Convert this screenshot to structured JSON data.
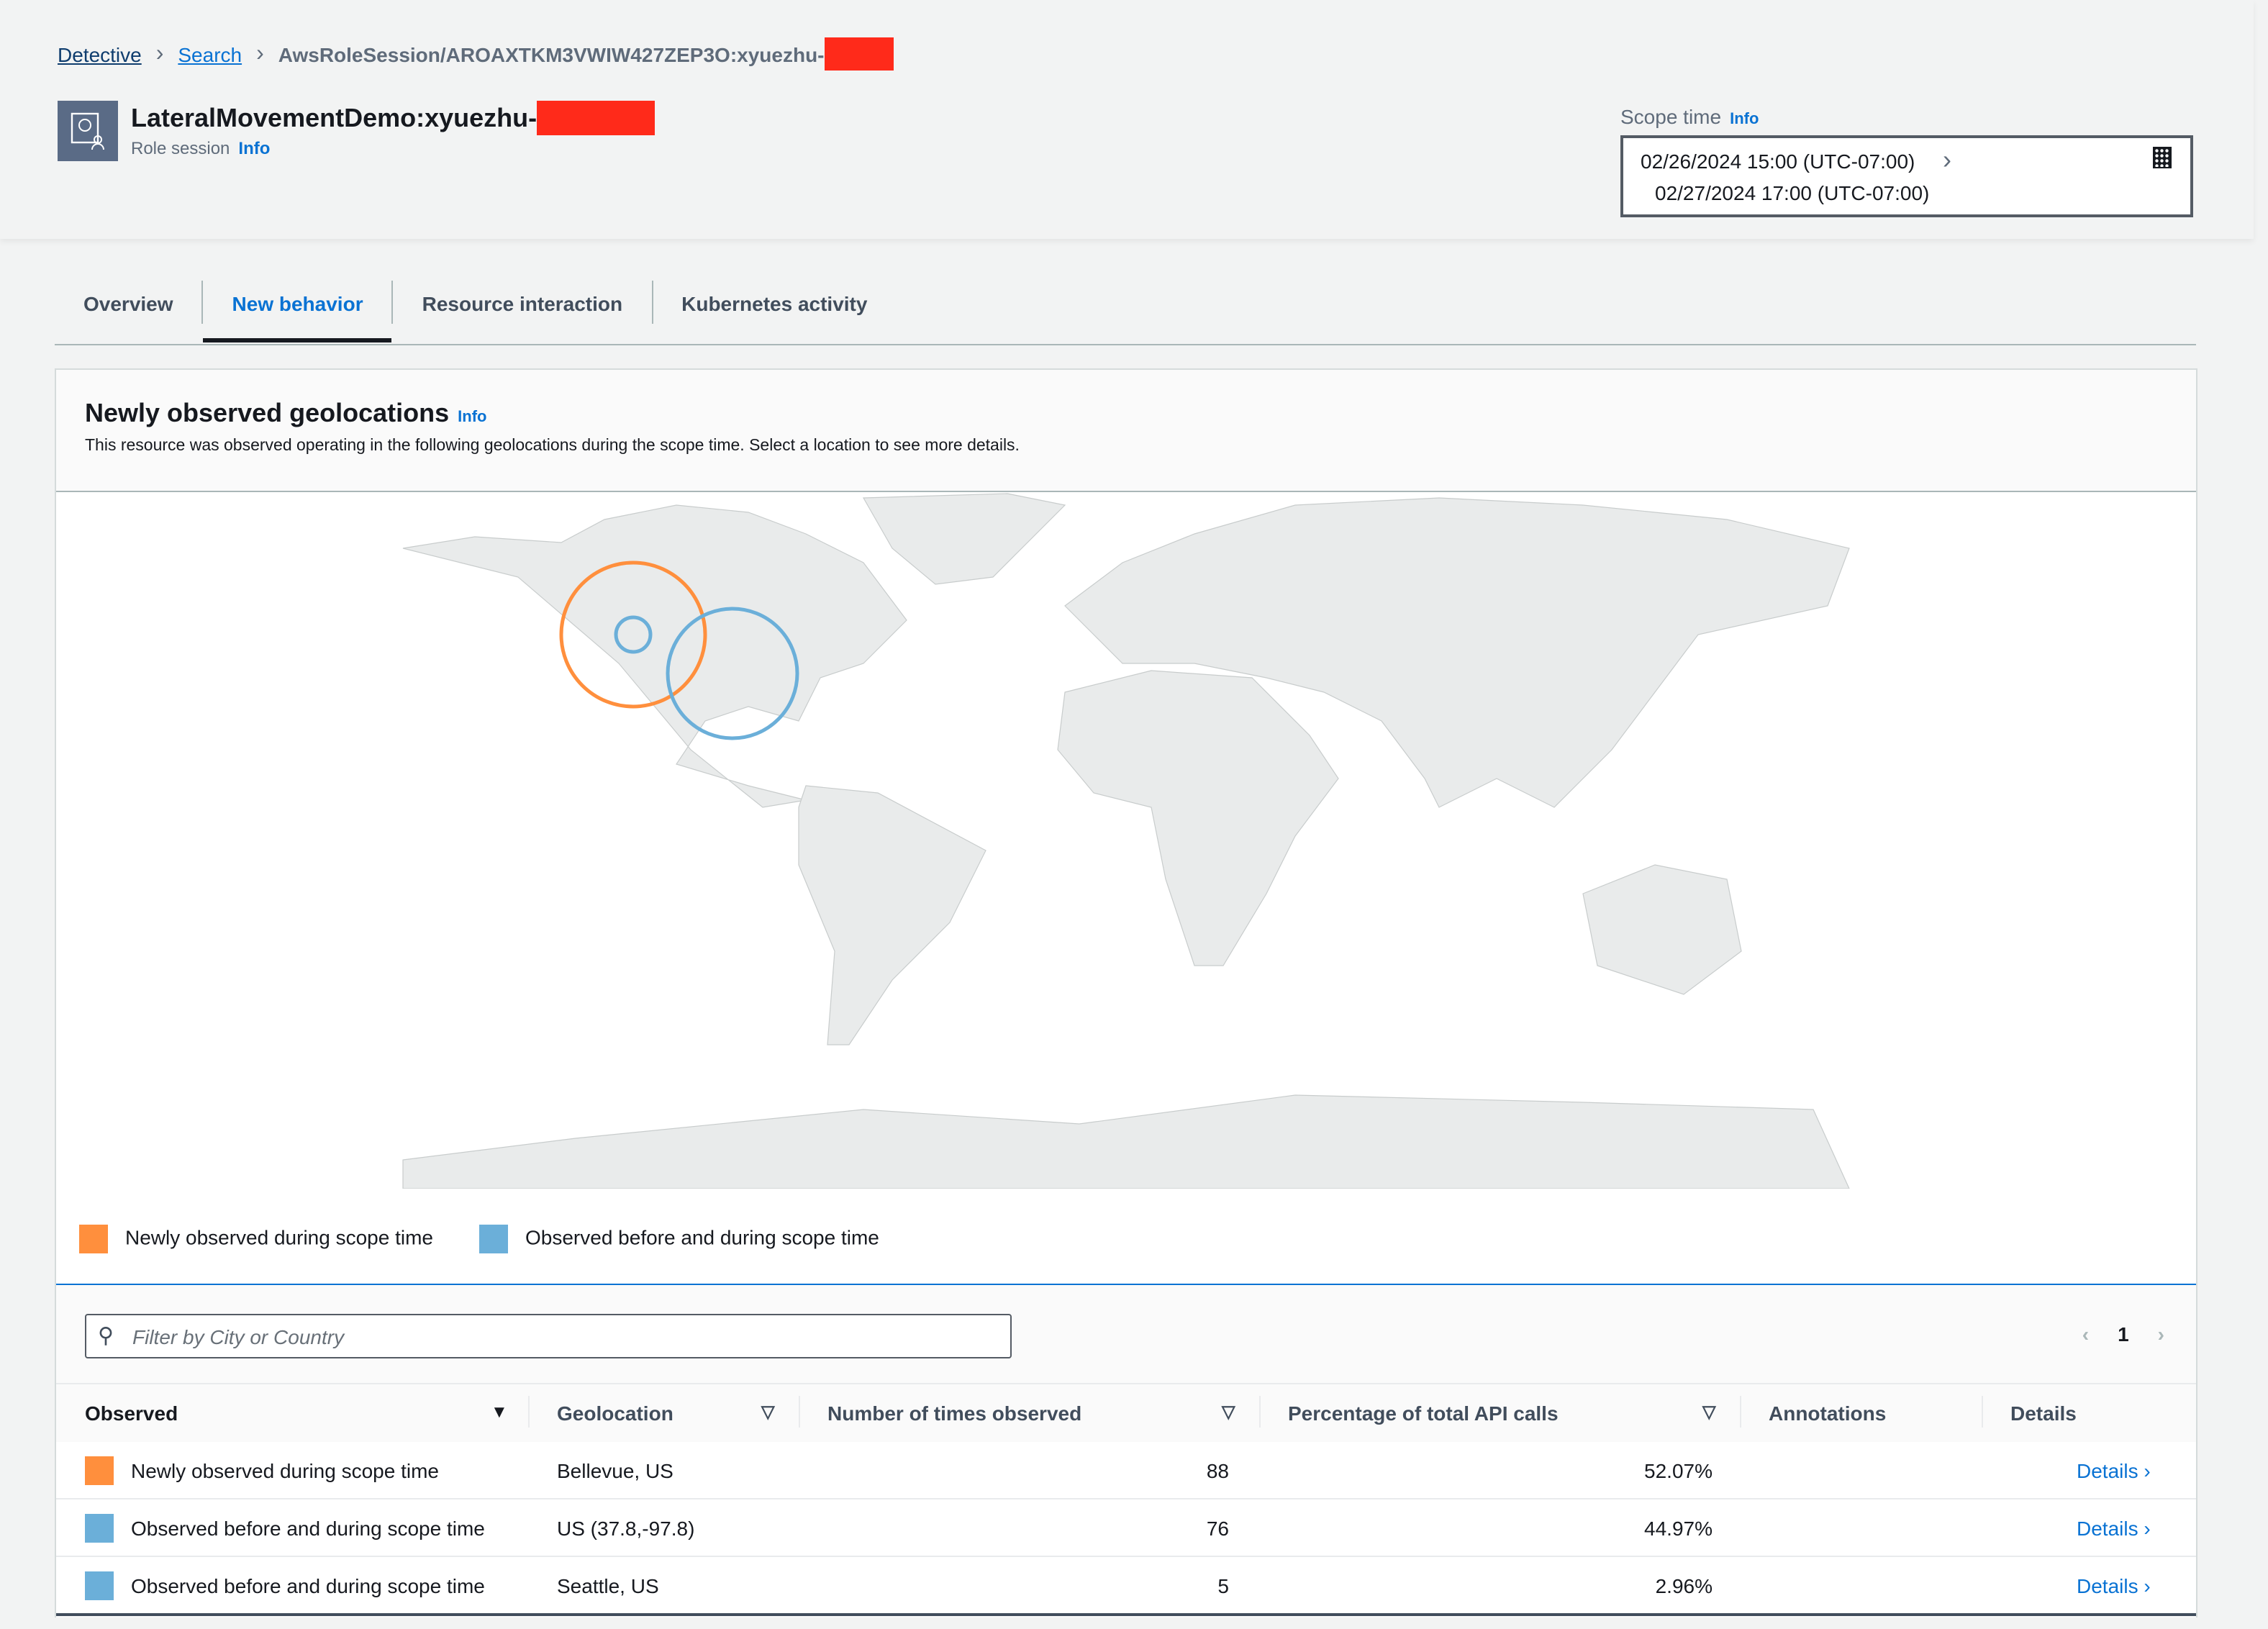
{
  "breadcrumb": [
    {
      "label": "Detective"
    },
    {
      "label": "Search"
    },
    {
      "label": "AwsRoleSession/AROAXTKM3VWIW427ZEP3O:xyuezhu-"
    }
  ],
  "header": {
    "title": "LateralMovementDemo:xyuezhu-",
    "subtitle": "Role session",
    "info": "Info"
  },
  "scope": {
    "label": "Scope time",
    "info": "Info",
    "start": "02/26/2024 15:00 (UTC-07:00)",
    "end": "02/27/2024 17:00 (UTC-07:00)"
  },
  "tabs": [
    {
      "label": "Overview"
    },
    {
      "label": "New behavior"
    },
    {
      "label": "Resource interaction"
    },
    {
      "label": "Kubernetes activity"
    }
  ],
  "panel": {
    "title": "Newly observed geolocations",
    "info": "Info",
    "description": "This resource was observed operating in the following geolocations during the scope time. Select a location to see more details."
  },
  "colors": {
    "new": "#ff8f3d",
    "before": "#6bafd9",
    "link": "#0972d3"
  },
  "legend": {
    "new": "Newly observed during scope time",
    "before": "Observed before and during scope time"
  },
  "filter": {
    "placeholder": "Filter by City or Country"
  },
  "pager": {
    "page": "1"
  },
  "columns": [
    "Observed",
    "Geolocation",
    "Number of times observed",
    "Percentage of total API calls",
    "Annotations",
    "Details"
  ],
  "rows": [
    {
      "observed": "Newly observed during scope time",
      "geo": "Bellevue, US",
      "count": "88",
      "pct": "52.07%",
      "annotations": "",
      "details": "Details"
    },
    {
      "observed": "Observed before and during scope time",
      "geo": "US (37.8,-97.8)",
      "count": "76",
      "pct": "44.97%",
      "annotations": "",
      "details": "Details"
    },
    {
      "observed": "Observed before and during scope time",
      "geo": "Seattle, US",
      "count": "5",
      "pct": "2.96%",
      "annotations": "",
      "details": "Details"
    }
  ]
}
